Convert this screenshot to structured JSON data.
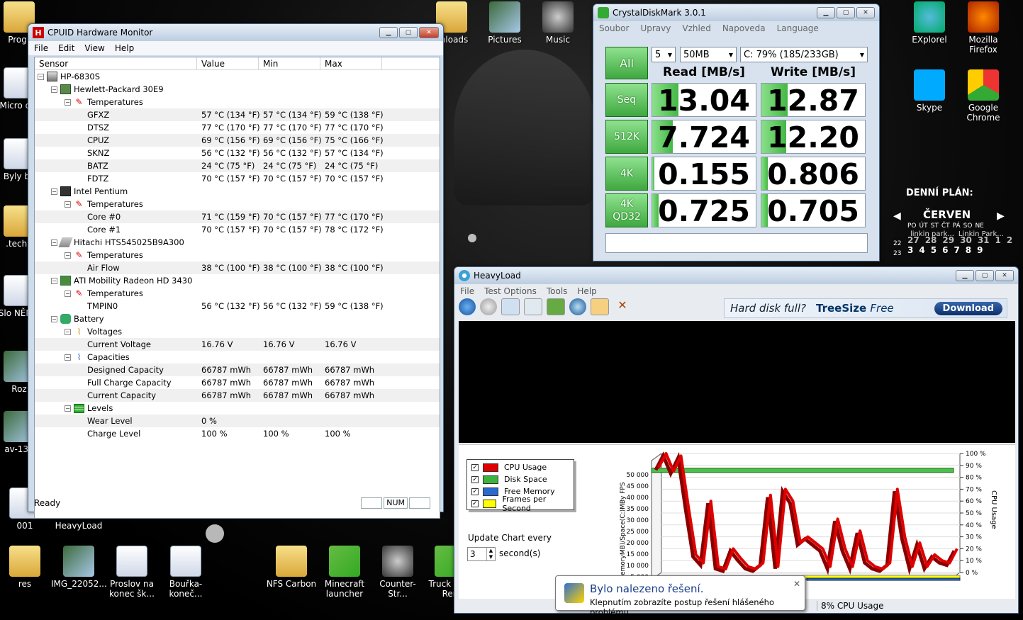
{
  "desktop": {
    "icons": [
      {
        "label": "Progr",
        "type": "folder"
      },
      {
        "label": "Micro offi",
        "type": "doc"
      },
      {
        "label": "Byly by",
        "type": "doc"
      },
      {
        "label": ".techn",
        "type": "folder"
      },
      {
        "label": "Slo NĚMO",
        "type": "doc"
      },
      {
        "label": "Roz",
        "type": "img"
      },
      {
        "label": "av-130",
        "type": "img"
      },
      {
        "label": "001",
        "type": "doc"
      },
      {
        "label": "HeavyLoad",
        "type": "doc"
      },
      {
        "label": "res",
        "type": "folder"
      },
      {
        "label": "IMG_22052...",
        "type": "img"
      },
      {
        "label": "Proslov na konec šk...",
        "type": "doc"
      },
      {
        "label": "Bouřka-koneč...",
        "type": "doc"
      },
      {
        "label": "NFS Carbon",
        "type": "folder"
      },
      {
        "label": "Minecraft launcher",
        "type": "game"
      },
      {
        "label": "Counter-Str...",
        "type": "cs"
      },
      {
        "label": "Truck F by Ren",
        "type": "game"
      },
      {
        "label": "vnloads",
        "type": "folder"
      },
      {
        "label": "Pictures",
        "type": "img"
      },
      {
        "label": "Music",
        "type": "cd"
      },
      {
        "label": "EXplorel",
        "type": "ie"
      },
      {
        "label": "Mozilla Firefox",
        "type": "ff"
      },
      {
        "label": "Skype",
        "type": "sk"
      },
      {
        "label": "Google Chrome",
        "type": "ch"
      }
    ],
    "planner": {
      "title": "DENNÍ PLÁN:",
      "month": "ČERVEN",
      "weekdays": [
        "PO",
        "ÚT",
        "ST",
        "ČT",
        "PÁ",
        "SO",
        "NE"
      ],
      "row1": [
        "27",
        "28",
        "29",
        "30",
        "31",
        "1",
        "2"
      ],
      "row2": [
        "3",
        "4",
        "5",
        "6",
        "7",
        "8",
        "9"
      ],
      "weeks": [
        "22",
        "23"
      ],
      "note1": "linkin park...",
      "note2": "Linkin Park..."
    }
  },
  "hwm": {
    "title": "CPUID Hardware Monitor",
    "menu": [
      "File",
      "Edit",
      "View",
      "Help"
    ],
    "columns": [
      "Sensor",
      "Value",
      "Min",
      "Max"
    ],
    "rows": [
      {
        "level": 0,
        "icon": "pc",
        "label": "HP-6830S",
        "value": "",
        "min": "",
        "max": ""
      },
      {
        "level": 1,
        "icon": "mb",
        "label": "Hewlett-Packard 30E9",
        "value": "",
        "min": "",
        "max": ""
      },
      {
        "level": 2,
        "icon": "thermo",
        "label": "Temperatures",
        "value": "",
        "min": "",
        "max": ""
      },
      {
        "level": 3,
        "icon": "",
        "label": "GFXZ",
        "value": "57 °C  (134 °F)",
        "min": "57 °C  (134 °F)",
        "max": "59 °C  (138 °F)"
      },
      {
        "level": 3,
        "icon": "",
        "label": "DTSZ",
        "value": "77 °C  (170 °F)",
        "min": "77 °C  (170 °F)",
        "max": "77 °C  (170 °F)"
      },
      {
        "level": 3,
        "icon": "",
        "label": "CPUZ",
        "value": "69 °C  (156 °F)",
        "min": "69 °C  (156 °F)",
        "max": "75 °C  (166 °F)"
      },
      {
        "level": 3,
        "icon": "",
        "label": "SKNZ",
        "value": "56 °C  (132 °F)",
        "min": "56 °C  (132 °F)",
        "max": "57 °C  (134 °F)"
      },
      {
        "level": 3,
        "icon": "",
        "label": "BATZ",
        "value": "24 °C  (75 °F)",
        "min": "24 °C  (75 °F)",
        "max": "24 °C  (75 °F)"
      },
      {
        "level": 3,
        "icon": "",
        "label": "FDTZ",
        "value": "70 °C  (157 °F)",
        "min": "70 °C  (157 °F)",
        "max": "70 °C  (157 °F)"
      },
      {
        "level": 1,
        "icon": "chip",
        "label": "Intel Pentium",
        "value": "",
        "min": "",
        "max": ""
      },
      {
        "level": 2,
        "icon": "thermo",
        "label": "Temperatures",
        "value": "",
        "min": "",
        "max": ""
      },
      {
        "level": 3,
        "icon": "",
        "label": "Core #0",
        "value": "71 °C  (159 °F)",
        "min": "70 °C  (157 °F)",
        "max": "77 °C  (170 °F)"
      },
      {
        "level": 3,
        "icon": "",
        "label": "Core #1",
        "value": "70 °C  (157 °F)",
        "min": "70 °C  (157 °F)",
        "max": "78 °C  (172 °F)"
      },
      {
        "level": 1,
        "icon": "hdd",
        "label": "Hitachi HTS545025B9A300",
        "value": "",
        "min": "",
        "max": ""
      },
      {
        "level": 2,
        "icon": "thermo",
        "label": "Temperatures",
        "value": "",
        "min": "",
        "max": ""
      },
      {
        "level": 3,
        "icon": "",
        "label": "Air Flow",
        "value": "38 °C  (100 °F)",
        "min": "38 °C  (100 °F)",
        "max": "38 °C  (100 °F)"
      },
      {
        "level": 1,
        "icon": "gpu",
        "label": "ATI Mobility Radeon HD 3430",
        "value": "",
        "min": "",
        "max": ""
      },
      {
        "level": 2,
        "icon": "thermo",
        "label": "Temperatures",
        "value": "",
        "min": "",
        "max": ""
      },
      {
        "level": 3,
        "icon": "",
        "label": "TMPIN0",
        "value": "56 °C  (132 °F)",
        "min": "56 °C  (132 °F)",
        "max": "59 °C  (138 °F)"
      },
      {
        "level": 1,
        "icon": "bat",
        "label": "Battery",
        "value": "",
        "min": "",
        "max": ""
      },
      {
        "level": 2,
        "icon": "volt",
        "label": "Voltages",
        "value": "",
        "min": "",
        "max": ""
      },
      {
        "level": 3,
        "icon": "",
        "label": "Current Voltage",
        "value": "16.76 V",
        "min": "16.76 V",
        "max": "16.76 V"
      },
      {
        "level": 2,
        "icon": "cap",
        "label": "Capacities",
        "value": "",
        "min": "",
        "max": ""
      },
      {
        "level": 3,
        "icon": "",
        "label": "Designed Capacity",
        "value": "66787 mWh",
        "min": "66787 mWh",
        "max": "66787 mWh"
      },
      {
        "level": 3,
        "icon": "",
        "label": "Full Charge Capacity",
        "value": "66787 mWh",
        "min": "66787 mWh",
        "max": "66787 mWh"
      },
      {
        "level": 3,
        "icon": "",
        "label": "Current Capacity",
        "value": "66787 mWh",
        "min": "66787 mWh",
        "max": "66787 mWh"
      },
      {
        "level": 2,
        "icon": "lvl",
        "label": "Levels",
        "value": "",
        "min": "",
        "max": ""
      },
      {
        "level": 3,
        "icon": "",
        "label": "Wear Level",
        "value": "0 %",
        "min": "",
        "max": ""
      },
      {
        "level": 3,
        "icon": "",
        "label": "Charge Level",
        "value": "100 %",
        "min": "100 %",
        "max": "100 %"
      }
    ],
    "status": "Ready",
    "num": "NUM"
  },
  "cdm": {
    "title": "CrystalDiskMark 3.0.1",
    "menu": [
      "Soubor",
      "Upravy",
      "Vzhled",
      "Napoveda",
      "Language"
    ],
    "all_label": "All",
    "runs": "5",
    "size": "50MB",
    "drive": "C: 79% (185/233GB)",
    "read_header": "Read [MB/s]",
    "write_header": "Write [MB/s]",
    "tests": [
      {
        "label": "Seq",
        "read": "13.04",
        "write": "12.87",
        "read_fill": 0.25,
        "write_fill": 0.25
      },
      {
        "label": "512K",
        "read": "7.724",
        "write": "12.20",
        "read_fill": 0.2,
        "write_fill": 0.24
      },
      {
        "label": "4K",
        "read": "0.155",
        "write": "0.806",
        "read_fill": 0.02,
        "write_fill": 0.06
      },
      {
        "label": "4K QD32",
        "read": "0.725",
        "write": "0.705",
        "read_fill": 0.06,
        "write_fill": 0.06
      }
    ]
  },
  "hl": {
    "title": "HeavyLoad",
    "menu": [
      "File",
      "Test Options",
      "Tools",
      "Help"
    ],
    "ad_text": "Hard disk full?",
    "ad_brand": "TreeSize",
    "ad_brand2": "Free",
    "ad_button": "Download",
    "legend": [
      {
        "label": "CPU Usage",
        "color": "#e00000"
      },
      {
        "label": "Disk Space",
        "color": "#3cb43c"
      },
      {
        "label": "Free Memory",
        "color": "#2a6ad0"
      },
      {
        "label": "Frames per Second",
        "color": "#ffff00"
      }
    ],
    "update_label": "Update Chart every",
    "update_value": "3",
    "seconds_label": "second(s)",
    "status_right": "8% CPU Usage"
  },
  "chart_data": {
    "type": "line",
    "title": "",
    "ylabel_left": "emoryMB)/Space(C:)MBy FPS",
    "ylabel_right": "CPU Usage",
    "left_ticks": [
      "50 000",
      "45 000",
      "40 000",
      "35 000",
      "30 000",
      "25 000",
      "20 000",
      "15 000",
      "10 000",
      "5 000"
    ],
    "right_ticks": [
      "100 %",
      "90 %",
      "80 %",
      "70 %",
      "60 %",
      "50 %",
      "40 %",
      "30 %",
      "20 %",
      "10 %",
      "0 %"
    ],
    "ylim": [
      0,
      100
    ],
    "series": [
      {
        "name": "CPU Usage",
        "values": [
          88,
          100,
          85,
          98,
          55,
          15,
          8,
          60,
          5,
          3,
          20,
          12,
          5,
          3,
          8,
          65,
          5,
          70,
          60,
          25,
          30,
          25,
          20,
          5,
          45,
          20,
          5,
          35,
          10,
          5,
          3,
          8,
          70,
          30,
          5,
          25,
          5,
          15,
          10,
          8,
          20
        ]
      },
      {
        "name": "Disk Space",
        "values": [
          90,
          90
        ]
      }
    ]
  },
  "balloon": {
    "title": "Bylo nalezeno řešení.",
    "message": "Klepnutím zobrazíte postup řešení hlášeného problému."
  }
}
